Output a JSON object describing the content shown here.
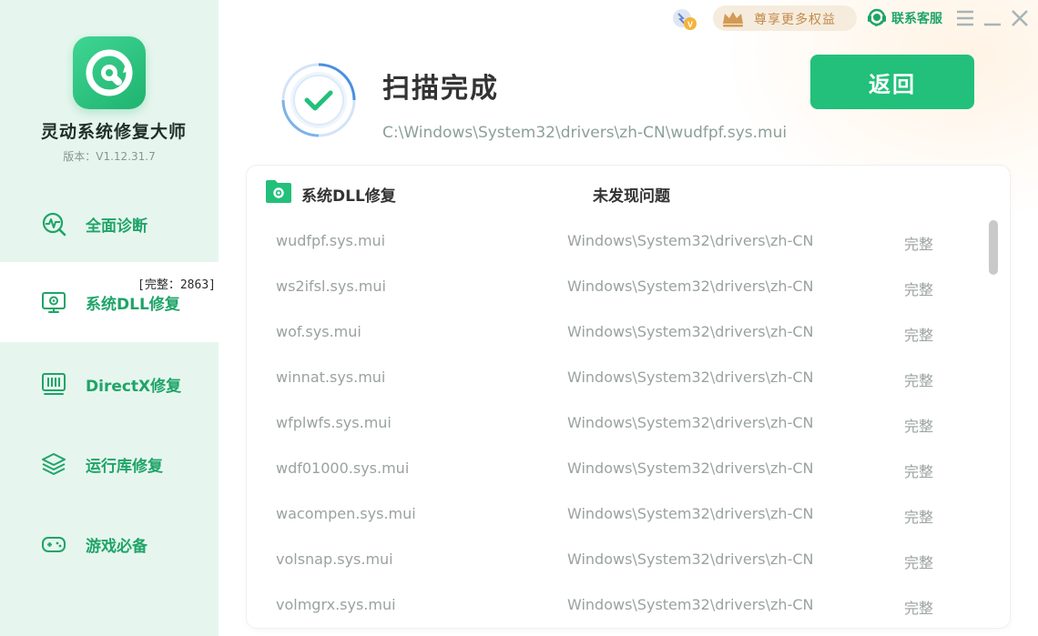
{
  "app": {
    "name": "灵动系统修复大师",
    "version": "版本：V1.12.31.7"
  },
  "sidebar": {
    "items": [
      {
        "label": "全面诊断",
        "icon": "diagnosis-icon"
      },
      {
        "label": "系统DLL修复",
        "icon": "dll-repair-icon",
        "count": "[完整：2863]"
      },
      {
        "label": "DirectX修复",
        "icon": "directx-icon"
      },
      {
        "label": "运行库修复",
        "icon": "runtime-layers-icon"
      },
      {
        "label": "游戏必备",
        "icon": "gamepad-icon"
      }
    ],
    "active_index": 1
  },
  "topbar": {
    "privilege": "尊享更多权益",
    "support": "联系客服"
  },
  "scan": {
    "title": "扫描完成",
    "path": "C:\\Windows\\System32\\drivers\\zh-CN\\wudfpf.sys.mui",
    "back_label": "返回"
  },
  "table": {
    "section_title": "系统DLL修复",
    "status": "未发现问题",
    "rows": [
      {
        "name": "wudfpf.sys.mui",
        "path": "Windows\\System32\\drivers\\zh-CN",
        "state": "完整"
      },
      {
        "name": "ws2ifsl.sys.mui",
        "path": "Windows\\System32\\drivers\\zh-CN",
        "state": "完整"
      },
      {
        "name": "wof.sys.mui",
        "path": "Windows\\System32\\drivers\\zh-CN",
        "state": "完整"
      },
      {
        "name": "winnat.sys.mui",
        "path": "Windows\\System32\\drivers\\zh-CN",
        "state": "完整"
      },
      {
        "name": "wfplwfs.sys.mui",
        "path": "Windows\\System32\\drivers\\zh-CN",
        "state": "完整"
      },
      {
        "name": "wdf01000.sys.mui",
        "path": "Windows\\System32\\drivers\\zh-CN",
        "state": "完整"
      },
      {
        "name": "wacompen.sys.mui",
        "path": "Windows\\System32\\drivers\\zh-CN",
        "state": "完整"
      },
      {
        "name": "volsnap.sys.mui",
        "path": "Windows\\System32\\drivers\\zh-CN",
        "state": "完整"
      },
      {
        "name": "volmgrx.sys.mui",
        "path": "Windows\\System32\\drivers\\zh-CN",
        "state": "完整"
      }
    ]
  },
  "colors": {
    "brand_green": "#22c07a",
    "sidebar_bg": "#e6f6ee",
    "accent_gold": "#c28a4b"
  }
}
